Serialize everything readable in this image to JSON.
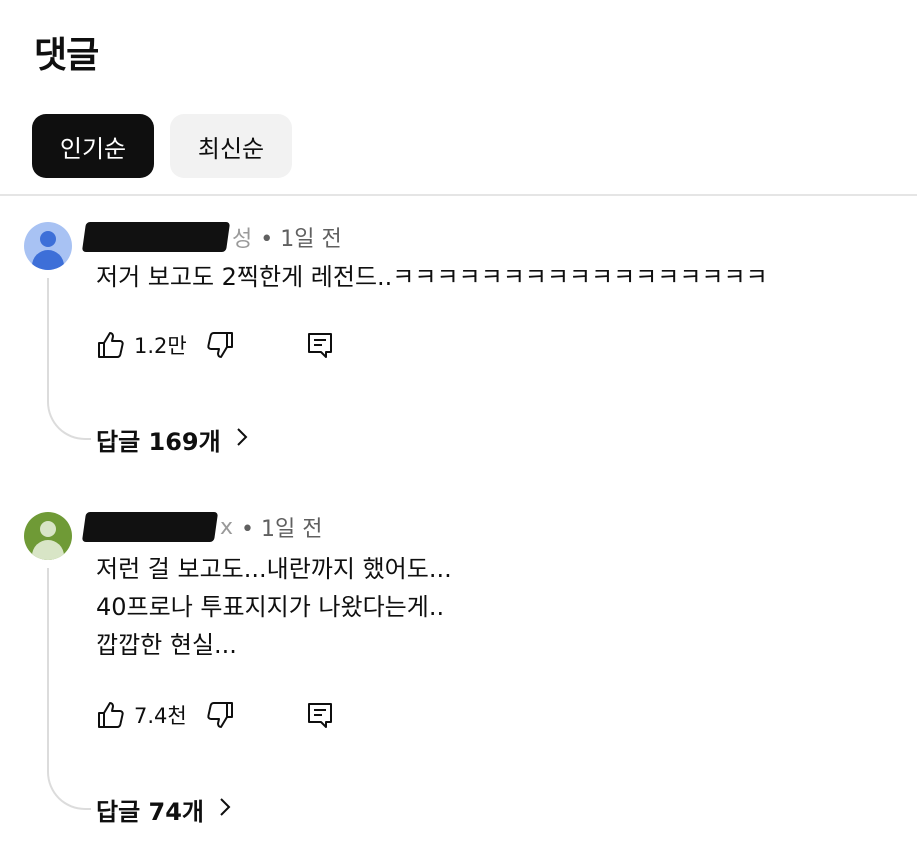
{
  "header": {
    "title": "댓글"
  },
  "sort_chips": [
    {
      "label": "인기순",
      "active": true
    },
    {
      "label": "최신순",
      "active": false
    }
  ],
  "comments": [
    {
      "avatar_color": "#4f81e8",
      "author_suffix": "성",
      "time": "• 1일 전",
      "text": "저거 보고도 2찍한게 레전드..ㅋㅋㅋㅋㅋㅋㅋㅋㅋㅋㅋㅋㅋㅋㅋㅋㅋ",
      "likes": "1.2만",
      "replies_label": "답글 169개",
      "icons": {
        "like": "thumbs-up-icon",
        "dislike": "thumbs-down-icon",
        "reply": "comment-icon",
        "more": "chevron-right-icon"
      }
    },
    {
      "avatar_color": "#7aa440",
      "author_suffix": "x",
      "time": "• 1일 전",
      "text": "저런 걸 보고도...내란까지 했어도...\n40프로나 투표지지가 나왔다는게..\n깝깝한 현실...",
      "likes": "7.4천",
      "replies_label": "답글 74개",
      "icons": {
        "like": "thumbs-up-icon",
        "dislike": "thumbs-down-icon",
        "reply": "comment-icon",
        "more": "chevron-right-icon"
      }
    }
  ],
  "colors": {
    "accent": "#0f0f0f",
    "chip_inactive": "#f2f2f2",
    "meta": "#606060"
  }
}
